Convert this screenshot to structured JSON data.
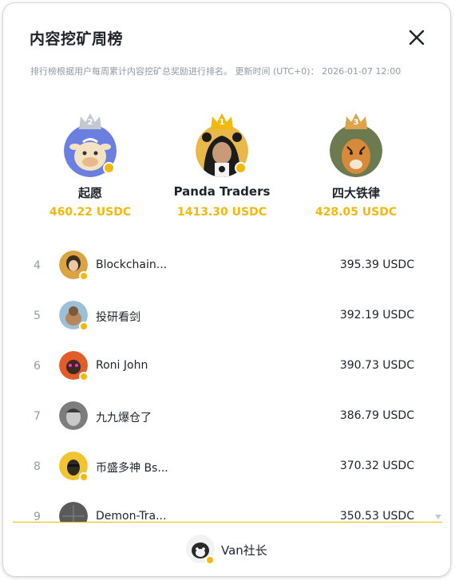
{
  "modal": {
    "title": "内容挖矿周榜",
    "description": "排行榜根据用户每周累计内容挖矿总奖励进行排名。 更新时间 (UTC+0)： 2026-01-07 12:00"
  },
  "podium": [
    {
      "rank": "2",
      "name": "起愿",
      "amount": "460.22 USDC",
      "avatar_icon": "cow-avatar-icon"
    },
    {
      "rank": "1",
      "name": "Panda Traders",
      "amount": "1413.30 USDC",
      "avatar_icon": "panda-hood-avatar-icon"
    },
    {
      "rank": "3",
      "name": "四大铁律",
      "amount": "428.05 USDC",
      "avatar_icon": "tiger-avatar-icon"
    }
  ],
  "list": [
    {
      "rank": "4",
      "name": "Blockchain...",
      "amount": "395.39 USDC"
    },
    {
      "rank": "5",
      "name": "投研看剑",
      "amount": "392.19 USDC"
    },
    {
      "rank": "6",
      "name": "Roni John",
      "amount": "390.73 USDC"
    },
    {
      "rank": "7",
      "name": "九九爆仓了",
      "amount": "386.79 USDC"
    },
    {
      "rank": "8",
      "name": "币盛多神 Bs...",
      "amount": "370.32 USDC"
    },
    {
      "rank": "9",
      "name": "Demon-Tra...",
      "amount": "350.53 USDC"
    }
  ],
  "current_user": {
    "name": "Van社长"
  },
  "colors": {
    "accent": "#f0b90b",
    "muted": "#929aa5",
    "text": "#1e2329"
  }
}
